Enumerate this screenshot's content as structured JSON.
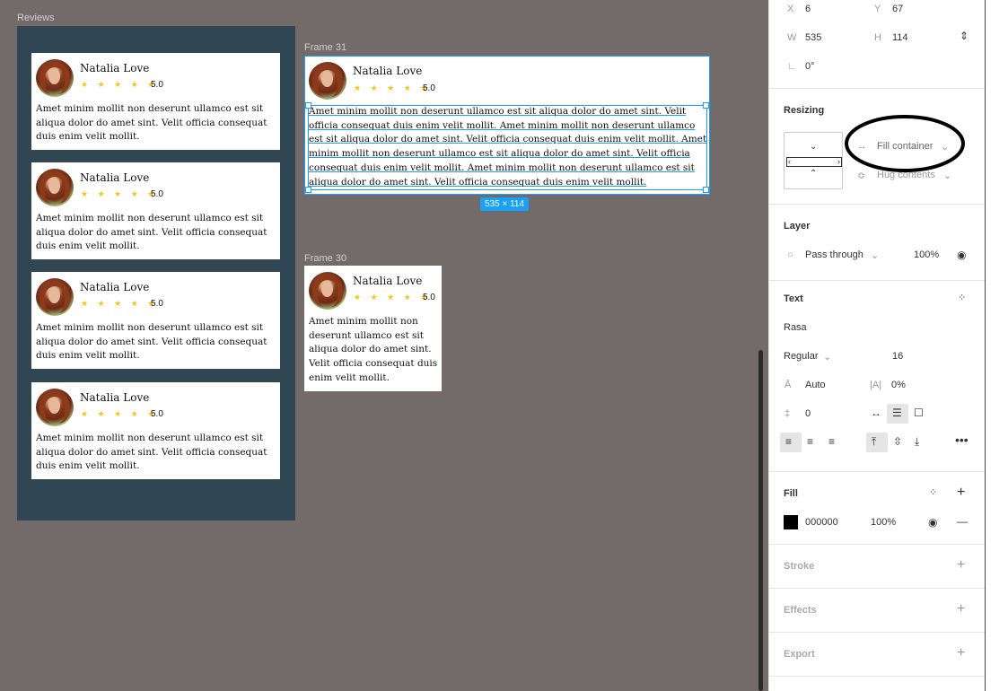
{
  "canvas": {
    "reviews_label": "Reviews",
    "frame31_label": "Frame 31",
    "frame30_label": "Frame 30",
    "size_badge": "535 × 114"
  },
  "review": {
    "name": "Natalia Love",
    "stars": "★ ★ ★ ★ ★",
    "rating": "5.0",
    "text": "Amet minim mollit non deserunt ullamco est sit aliqua dolor do amet sint. Velit officia consequat duis enim velit mollit.",
    "long_text": "Amet minim mollit non deserunt ullamco est sit aliqua dolor do amet sint. Velit officia consequat duis enim velit mollit. Amet minim mollit non deserunt ullamco est sit aliqua dolor do amet sint. Velit officia consequat duis enim velit mollit. Amet minim mollit non deserunt ullamco est sit aliqua dolor do amet sint. Velit officia consequat duis enim velit mollit. Amet minim mollit non deserunt ullamco est sit aliqua dolor do amet sint. Velit officia consequat duis enim velit mollit."
  },
  "panel": {
    "x_label": "X",
    "x_value": "6",
    "y_label": "Y",
    "y_value": "67",
    "w_label": "W",
    "w_value": "535",
    "h_label": "H",
    "h_value": "114",
    "rotation": "0°",
    "resizing_title": "Resizing",
    "fill_container": "Fill container",
    "hug_contents": "Hug contents",
    "layer_title": "Layer",
    "blend_mode": "Pass through",
    "layer_opacity": "100%",
    "text_title": "Text",
    "font_family": "Rasa",
    "font_weight": "Regular",
    "font_size": "16",
    "line_height": "Auto",
    "letter_spacing": "0%",
    "paragraph_spacing": "0",
    "fill_title": "Fill",
    "fill_hex": "000000",
    "fill_opacity": "100%",
    "stroke_title": "Stroke",
    "effects_title": "Effects",
    "export_title": "Export"
  },
  "colors": {
    "canvas_bg": "#736a6a",
    "frame_bg": "#304753",
    "selection": "#18a0fb",
    "star": "#f5c518"
  }
}
